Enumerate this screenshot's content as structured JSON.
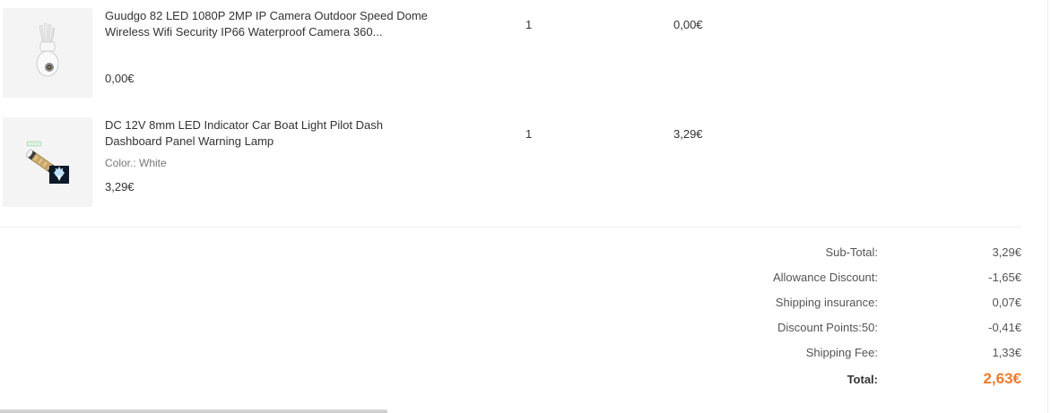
{
  "items": [
    {
      "image": "ip-camera-image",
      "title": "Guudgo 82 LED 1080P 2MP IP Camera Outdoor Speed Dome Wireless Wifi Security IP66 Waterproof Camera 360...",
      "variant": "",
      "price": "0,00€",
      "quantity": "1",
      "subtotal": "0,00€"
    },
    {
      "image": "led-indicator-lamp-image",
      "title": "DC 12V 8mm LED Indicator Car Boat Light Pilot Dash Dashboard Panel Warning Lamp",
      "variant": "Color.: White",
      "price": "3,29€",
      "quantity": "1",
      "subtotal": "3,29€"
    }
  ],
  "summary": {
    "subtotal": {
      "label": "Sub-Total:",
      "value": "3,29€"
    },
    "allowance_discount": {
      "label": "Allowance Discount:",
      "value": "-1,65€"
    },
    "shipping_insurance": {
      "label": "Shipping insurance:",
      "value": "0,07€"
    },
    "discount_points": {
      "label": "Discount Points:50:",
      "value": "-0,41€"
    },
    "shipping_fee": {
      "label": "Shipping Fee:",
      "value": "1,33€"
    },
    "total": {
      "label": "Total:",
      "value": "2,63€"
    }
  },
  "colors": {
    "total_accent": "#ef7a2a",
    "text": "#333333",
    "muted": "#777777",
    "thumb_bg": "#f4f4f4"
  }
}
